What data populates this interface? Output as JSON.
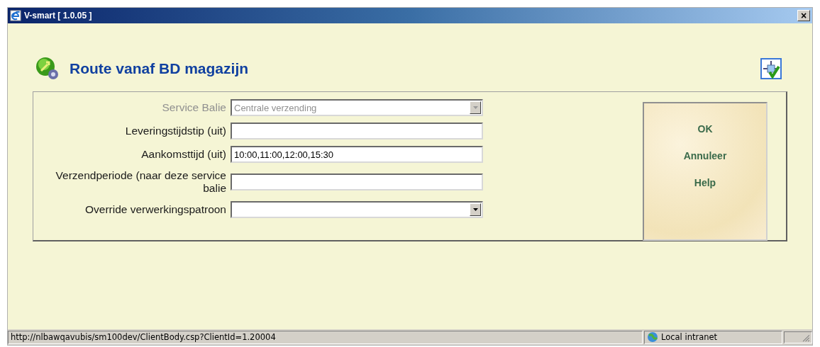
{
  "window": {
    "title": "V-smart [ 1.0.05 ]",
    "close": "×"
  },
  "page": {
    "title": "Route vanaf BD magazijn"
  },
  "fields": [
    {
      "label": "Service Balie",
      "kind": "select",
      "value": "Centrale verzending",
      "disabled": true
    },
    {
      "label": "Leveringstijdstip (uit)",
      "kind": "text",
      "disabled": false
    },
    {
      "label": "Aankomsttijd (uit)",
      "kind": "text",
      "value": "10:00,11:00,12:00,15:30",
      "disabled": false
    },
    {
      "label": "Verzendperiode (naar deze service balie",
      "kind": "text",
      "disabled": false
    },
    {
      "label": "Override verwerkingspatroon",
      "kind": "select",
      "disabled": false
    }
  ],
  "buttons": [
    "OK",
    "Annuleer",
    "Help"
  ],
  "status_bar": {
    "url": "http://nlbawqavubis/sm100dev/ClientBody.csp?ClientId=1.20004",
    "zone": "Local intranet"
  }
}
